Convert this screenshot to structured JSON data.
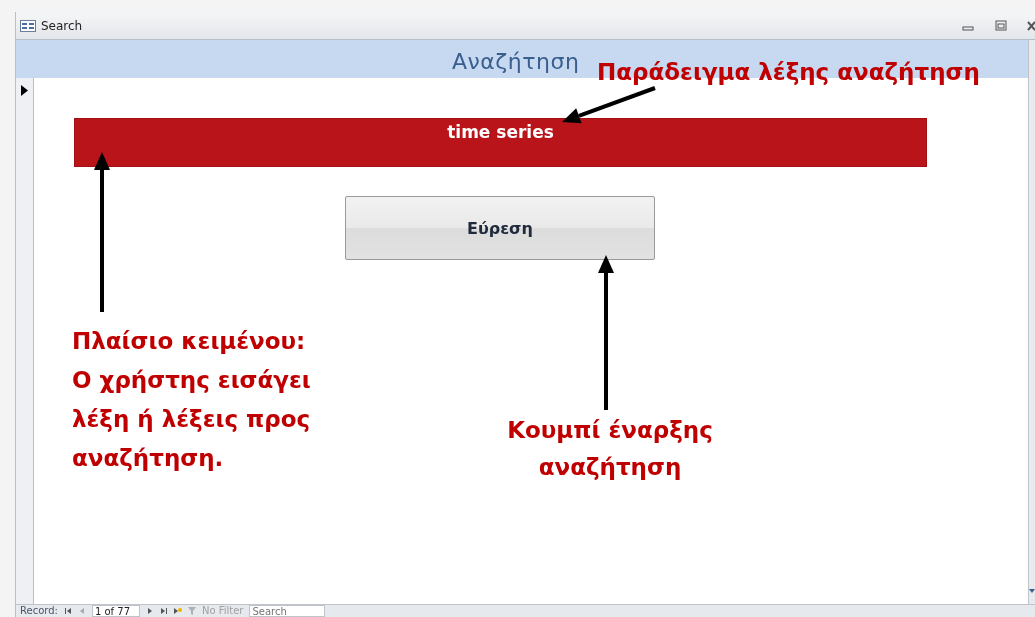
{
  "window": {
    "title": "Search"
  },
  "form": {
    "header": "Αναζήτηση",
    "search_field": {
      "value": "time series"
    },
    "find_button": {
      "label": "Εύρεση"
    }
  },
  "annotations": [
    {
      "kind": "top",
      "text": "Παράδειγμα λέξης αναζήτηση"
    },
    {
      "kind": "left",
      "text": "Πλαίσιο κειμένου:\nΟ χρήστης εισάγει\nλέξη ή λέξεις προς\nαναζήτηση."
    },
    {
      "kind": "bottom",
      "text": "Κουμπί έναρξης\nαναζήτηση"
    }
  ],
  "navigation_bar": {
    "label": "Record:",
    "position": "1 of 77",
    "filter": {
      "label": "No Filter",
      "filtered": false
    },
    "search": {
      "placeholder": "Search"
    }
  }
}
